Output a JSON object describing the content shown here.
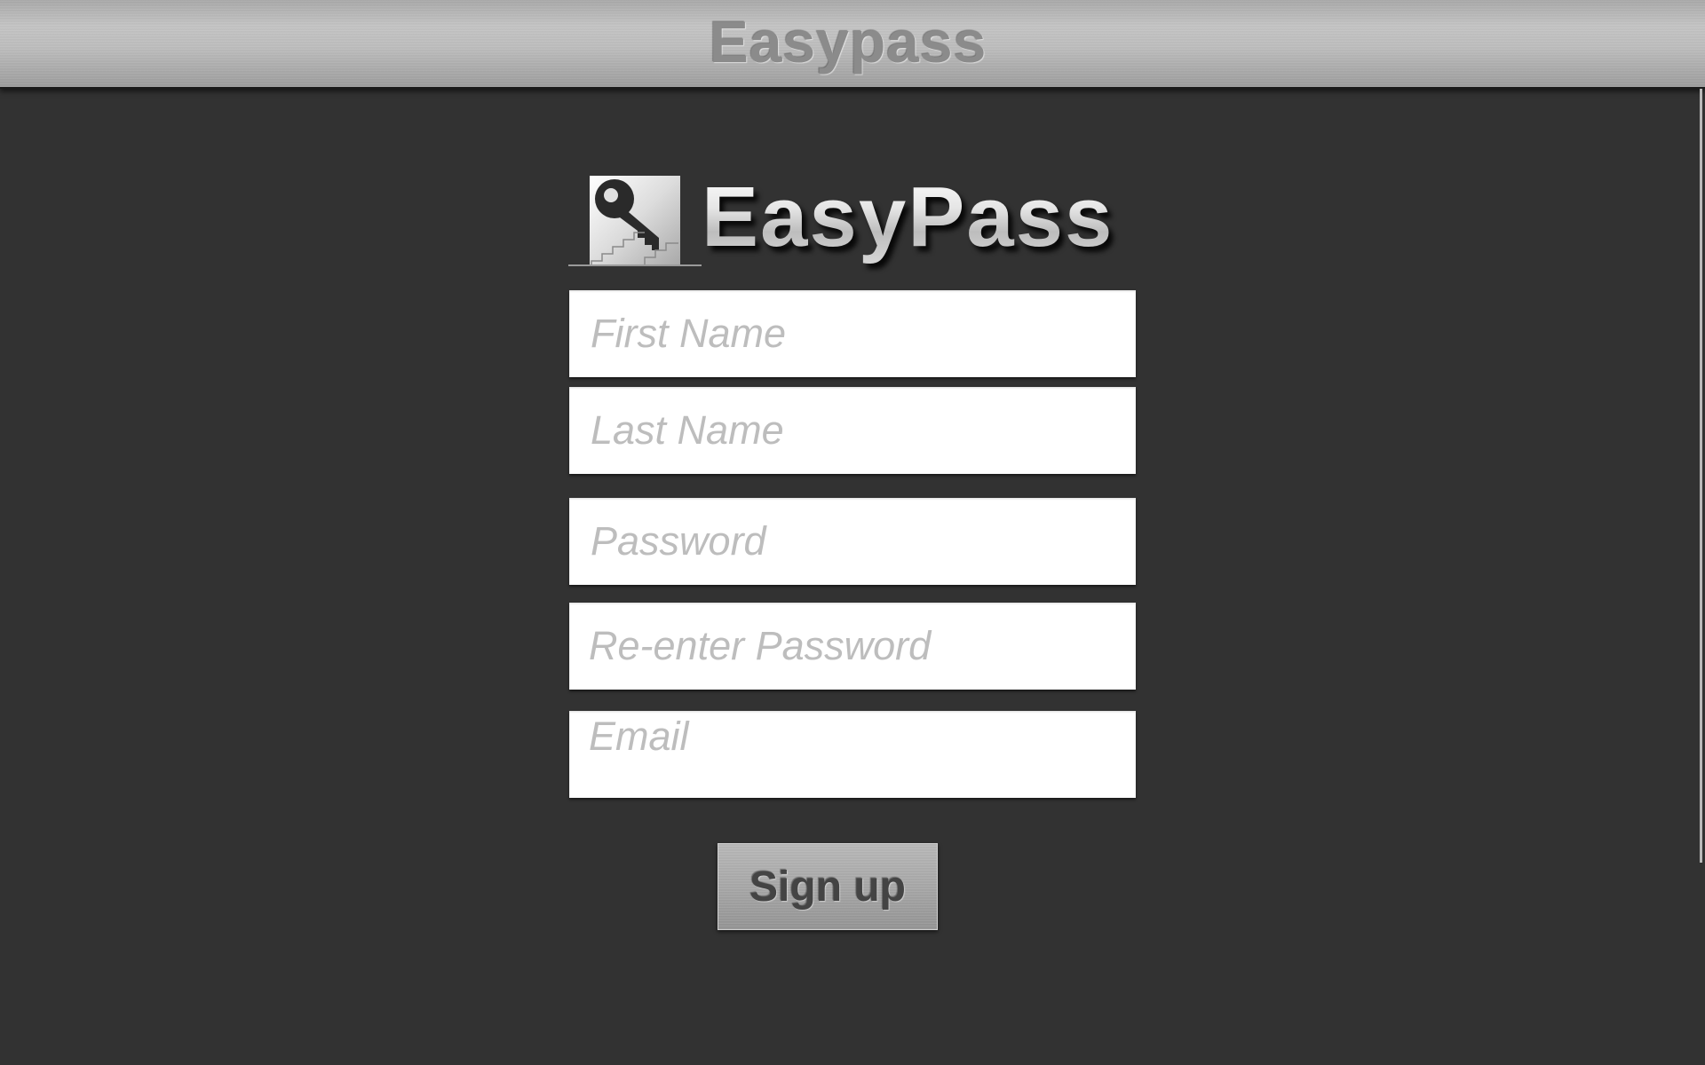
{
  "window": {
    "title": "Easypass"
  },
  "logo": {
    "text": "EasyPass",
    "icon": "key-stairs-icon"
  },
  "form": {
    "first_name": {
      "placeholder": "First Name",
      "value": ""
    },
    "last_name": {
      "placeholder": "Last Name",
      "value": ""
    },
    "password": {
      "placeholder": "Password",
      "value": ""
    },
    "reenter_password": {
      "placeholder": "Re-enter Password",
      "value": ""
    },
    "email": {
      "placeholder": "Email",
      "value": ""
    },
    "signup_label": "Sign up"
  },
  "colors": {
    "background": "#323232",
    "titlebar": "#b5b5b5",
    "field": "#ffffff",
    "placeholder": "#bdbdbd",
    "button": "#a8a8a8"
  }
}
